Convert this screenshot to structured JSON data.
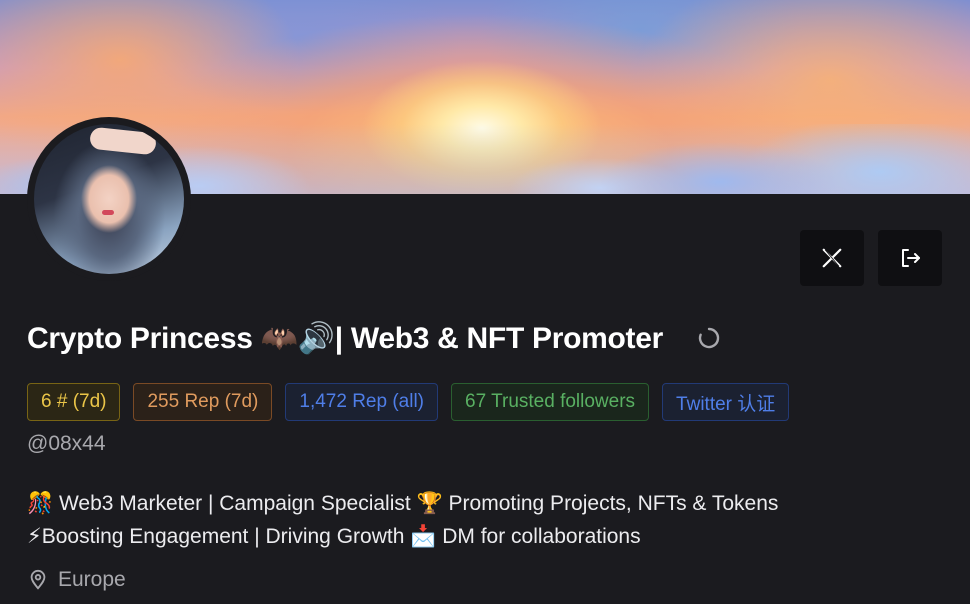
{
  "profile": {
    "display_name": "Crypto Princess 🦇🔊| Web3 & NFT Promoter",
    "handle": "@08x44",
    "bio_line1": "🎊 Web3 Marketer | Campaign Specialist 🏆 Promoting Projects, NFTs & Tokens",
    "bio_line2": "⚡Boosting Engagement | Driving Growth 📩 DM for collaborations",
    "location": "Europe"
  },
  "badges": [
    {
      "label": "6 # (7d)",
      "color": "#eac548"
    },
    {
      "label": "255 Rep (7d)",
      "color": "#e09b5e"
    },
    {
      "label": "1,472 Rep (all)",
      "color": "#4f7ee8"
    },
    {
      "label": "67 Trusted followers",
      "color": "#59b062"
    },
    {
      "label": "Twitter 认证",
      "color": "#4f7ee8"
    }
  ],
  "actions": {
    "x_icon": "x-logo-icon",
    "logout_icon": "logout-icon"
  },
  "colors": {
    "background": "#1b1b1f",
    "button_bg": "#0f0f12"
  }
}
